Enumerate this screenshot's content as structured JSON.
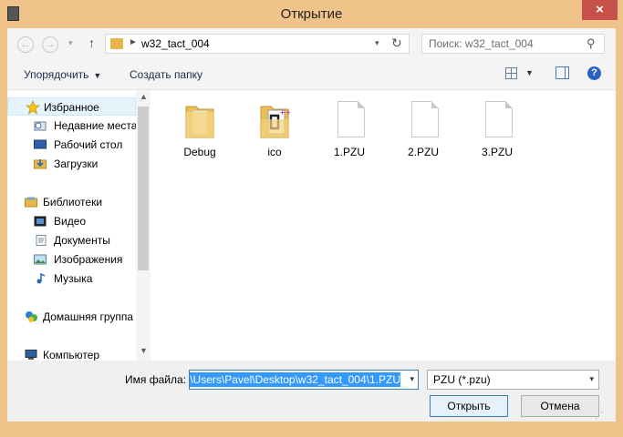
{
  "window": {
    "title": "Открытие",
    "close_symbol": "×"
  },
  "nav": {
    "back_symbol": "←",
    "forward_symbol": "→",
    "recent_symbol": "▾",
    "up_symbol": "↑",
    "address_chevron": "►",
    "address_path": "w32_tact_004",
    "address_dropdown_symbol": "▾",
    "refresh_symbol": "↻",
    "search_placeholder": "Поиск: w32_tact_004",
    "search_symbol": "⚲"
  },
  "toolbar": {
    "organize_label": "Упорядочить",
    "organize_caret": "▼",
    "new_folder_label": "Создать папку",
    "view_caret": "▼",
    "help_symbol": "?"
  },
  "sidebar": {
    "items": [
      {
        "label": "Избранное",
        "icon": "star-icon",
        "selected": true
      },
      {
        "label": "Недавние места",
        "icon": "recent-places-icon"
      },
      {
        "label": "Рабочий стол",
        "icon": "desktop-icon"
      },
      {
        "label": "Загрузки",
        "icon": "downloads-icon"
      },
      {
        "label": "Библиотеки",
        "icon": "libraries-icon"
      },
      {
        "label": "Видео",
        "icon": "video-icon"
      },
      {
        "label": "Документы",
        "icon": "documents-icon"
      },
      {
        "label": "Изображения",
        "icon": "pictures-icon"
      },
      {
        "label": "Музыка",
        "icon": "music-icon"
      },
      {
        "label": "Домашняя группа",
        "icon": "homegroup-icon"
      },
      {
        "label": "Компьютер",
        "icon": "computer-icon"
      }
    ],
    "scroll_up_symbol": "▲",
    "scroll_down_symbol": "▼"
  },
  "files": [
    {
      "name": "Debug",
      "type": "folder",
      "icon": "folder-icon"
    },
    {
      "name": "ico",
      "type": "folder",
      "icon": "folder-icon"
    },
    {
      "name": "1.PZU",
      "type": "file",
      "icon": "file-icon"
    },
    {
      "name": "2.PZU",
      "type": "file",
      "icon": "file-icon"
    },
    {
      "name": "3.PZU",
      "type": "file",
      "icon": "file-icon"
    }
  ],
  "footer": {
    "filename_label": "Имя файла:",
    "filename_value": ":\\Users\\Pavel\\Desktop\\w32_tact_004\\1.PZU",
    "filename_dropdown_symbol": "▾",
    "filetype_value": "PZU (*.pzu)",
    "filetype_dropdown_symbol": "▾",
    "open_label": "Открыть",
    "cancel_label": "Отмена"
  },
  "colors": {
    "frame": "#f0c38a",
    "close_button": "#c7504a",
    "selection": "#3399ff",
    "folder": "#e6b84a"
  }
}
